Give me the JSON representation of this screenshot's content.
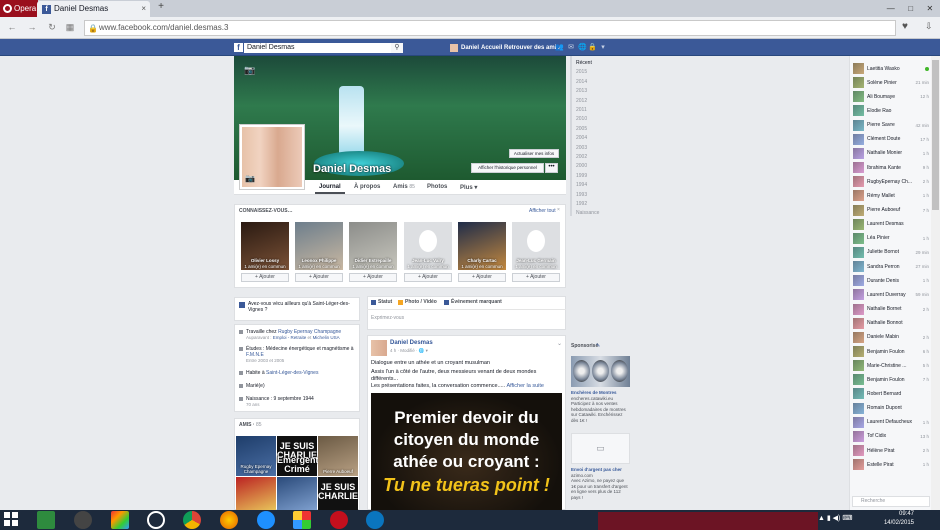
{
  "browser": {
    "menu_label": "Opera",
    "tab_title": "Daniel Desmas",
    "tab_close": "×",
    "url": "www.facebook.com/daniel.desmas.3",
    "window_controls": [
      "—",
      "□",
      "✕"
    ]
  },
  "fb_header": {
    "search_value": "Daniel Desmas",
    "user_name": "Daniel",
    "home_label": "Accueil",
    "find_friends_label": "Retrouver des amis"
  },
  "timeline_years": [
    "Récent",
    "2015",
    "2014",
    "2013",
    "2012",
    "2011",
    "2010",
    "2005",
    "2004",
    "2003",
    "2002",
    "2000",
    "1999",
    "1994",
    "1993",
    "1992",
    "Naissance"
  ],
  "profile": {
    "name": "Daniel Desmas",
    "update_info_label": "Actualiser mes infos",
    "activity_log_label": "Afficher l'historique personnel",
    "more_dots": "•••",
    "nav": [
      {
        "label": "Journal"
      },
      {
        "label": "À propos"
      },
      {
        "label": "Amis",
        "count": "85"
      },
      {
        "label": "Photos"
      },
      {
        "label": "Plus ▾"
      }
    ]
  },
  "pymk": {
    "title": "CONNAISSEZ-VOUS…",
    "see_all": "Afficher tout",
    "close": "×",
    "add_label": "Ajouter",
    "people": [
      {
        "name": "Olivier Lossy",
        "mutual": "1 ami(e) en commun"
      },
      {
        "name": "Leonox Philippe",
        "mutual": "1 ami(e) en commun"
      },
      {
        "name": "Didier Estrepaille",
        "mutual": "1 ami(e) en commun"
      },
      {
        "name": "Jean-Luc Valry",
        "mutual": "1 ami(e) en commun"
      },
      {
        "name": "Charly Cartac",
        "mutual": "1 ami(e) en commun"
      },
      {
        "name": "Jean-Luc Germain",
        "mutual": "1 ami(e) en commun"
      }
    ]
  },
  "visit_prompt": "Avez-vous vécu ailleurs qu'à Saint-Léger-des-Vignes ?",
  "about": {
    "work": {
      "prefix": "Travaille chez ",
      "link": "Rugby Epernay Champagne",
      "sub_prefix": "Auparavant : ",
      "sub_link": "Emploi - Retraite",
      "sub_mid": " et ",
      "sub_link2": "Michelin USA"
    },
    "study": {
      "prefix": "Études : Médecine énergétique et magnétisme à ",
      "link": "F.M.N.E",
      "sub": "Entre 2003 et 2005"
    },
    "lives": {
      "prefix": "Habite à ",
      "link": "Saint-Léger-des-Vignes"
    },
    "status": "Marié(e)",
    "birth": {
      "text": "Naissance : 9 septembre 1944",
      "sub": "70 ans"
    }
  },
  "friends": {
    "title": "AMIS",
    "count": "85",
    "tiles": [
      {
        "label": "Rugby Epernay Champagne"
      },
      {
        "label": "Je suis Charlie",
        "text": "JE SUIS CHARLIE"
      },
      {
        "label": "Laurent Desmas"
      },
      {
        "label": ""
      },
      {
        "label": ""
      },
      {
        "label": "",
        "text": "JE SUIS CHARLIE"
      }
    ],
    "tile2_sub": "Emergent Crimé",
    "tile3_sub": "Pierre Auboeuf"
  },
  "composer": {
    "status": "Statut",
    "photo": "Photo / Vidéo",
    "event": "Événement marquant",
    "placeholder": "Exprimez-vous"
  },
  "post": {
    "author": "Daniel Desmas",
    "meta": "4 h · Modifié · 🌐 ▾",
    "line1": "Dialogue entre un athée et un croyant musulman",
    "line2": "Assis l'un à côté de l'autre, deux messieurs venant de deux mondes différents...",
    "line3": "Les présentations faites, la conversation commence.....",
    "see_more": "Afficher la suite",
    "image_lines": [
      "Premier devoir du",
      "citoyen du monde",
      "athée ou croyant :",
      "Tu ne tueras point !"
    ]
  },
  "sponsored": {
    "title": "Sponsorisé",
    "edit": "✎",
    "ad1_title": "Enchères de Montres",
    "ad1_domain": "encheres.catawiki.eu",
    "ad1_text": "Participez à nos ventes hebdomadaires de montres sur Catawiki. Enchérissez dès 1€ !",
    "ad2_title": "Envoi d'argent pas cher",
    "ad2_domain": "azimo.com",
    "ad2_text": "Avec Azimo, ne payez que 1€ pour un transfert d'argent en ligne vers plus de 112 pays !"
  },
  "chat": {
    "search_placeholder": "Recherche",
    "contacts": [
      {
        "name": "Laetitia Wasko",
        "time": "●",
        "online": true
      },
      {
        "name": "Solène Pinier",
        "time": "21 min"
      },
      {
        "name": "Ali Boumaye",
        "time": "12 h"
      },
      {
        "name": "Elodie Rao",
        "time": ""
      },
      {
        "name": "Pierre Savre",
        "time": "42 min"
      },
      {
        "name": "Clément Doute",
        "time": "17 h"
      },
      {
        "name": "Nathalie Monier",
        "time": "1 h"
      },
      {
        "name": "Ibrahima Kante",
        "time": "9 h"
      },
      {
        "name": "RugbyEpernay Ch...",
        "time": "2 h"
      },
      {
        "name": "Rémy Mallet",
        "time": "1 h"
      },
      {
        "name": "Pierre Auboeuf",
        "time": "7 h"
      },
      {
        "name": "Laurent Desmas",
        "time": ""
      },
      {
        "name": "Léa Pinier",
        "time": "1 h"
      },
      {
        "name": "Juliette Bornot",
        "time": "29 min"
      },
      {
        "name": "Sandra Perron",
        "time": "27 min"
      },
      {
        "name": "Durante Denis",
        "time": "1 h"
      },
      {
        "name": "Laurent Duverray",
        "time": "59 min"
      },
      {
        "name": "Nathalie Bornet",
        "time": "2 h"
      },
      {
        "name": "Nathalie Bonnot",
        "time": ""
      },
      {
        "name": "Daniele Mabin",
        "time": "2 h"
      },
      {
        "name": "Benjamin Foulon",
        "time": "6 h"
      },
      {
        "name": "Marie-Christine ...",
        "time": "5 h"
      },
      {
        "name": "Benjamin Foulon",
        "time": "7 h"
      },
      {
        "name": "Robert Bernard",
        "time": ""
      },
      {
        "name": "Romain Dupont",
        "time": ""
      },
      {
        "name": "Laurent Defaucheux",
        "time": "1 h"
      },
      {
        "name": "Tof Cidix",
        "time": "13 h"
      },
      {
        "name": "Hélène Pirat",
        "time": "2 h"
      },
      {
        "name": "Estelle Pirat",
        "time": "1 h"
      }
    ]
  },
  "taskbar": {
    "time": "09:47",
    "date": "14/02/2015",
    "tray": "▲ ▮ ◀) ⌨"
  }
}
